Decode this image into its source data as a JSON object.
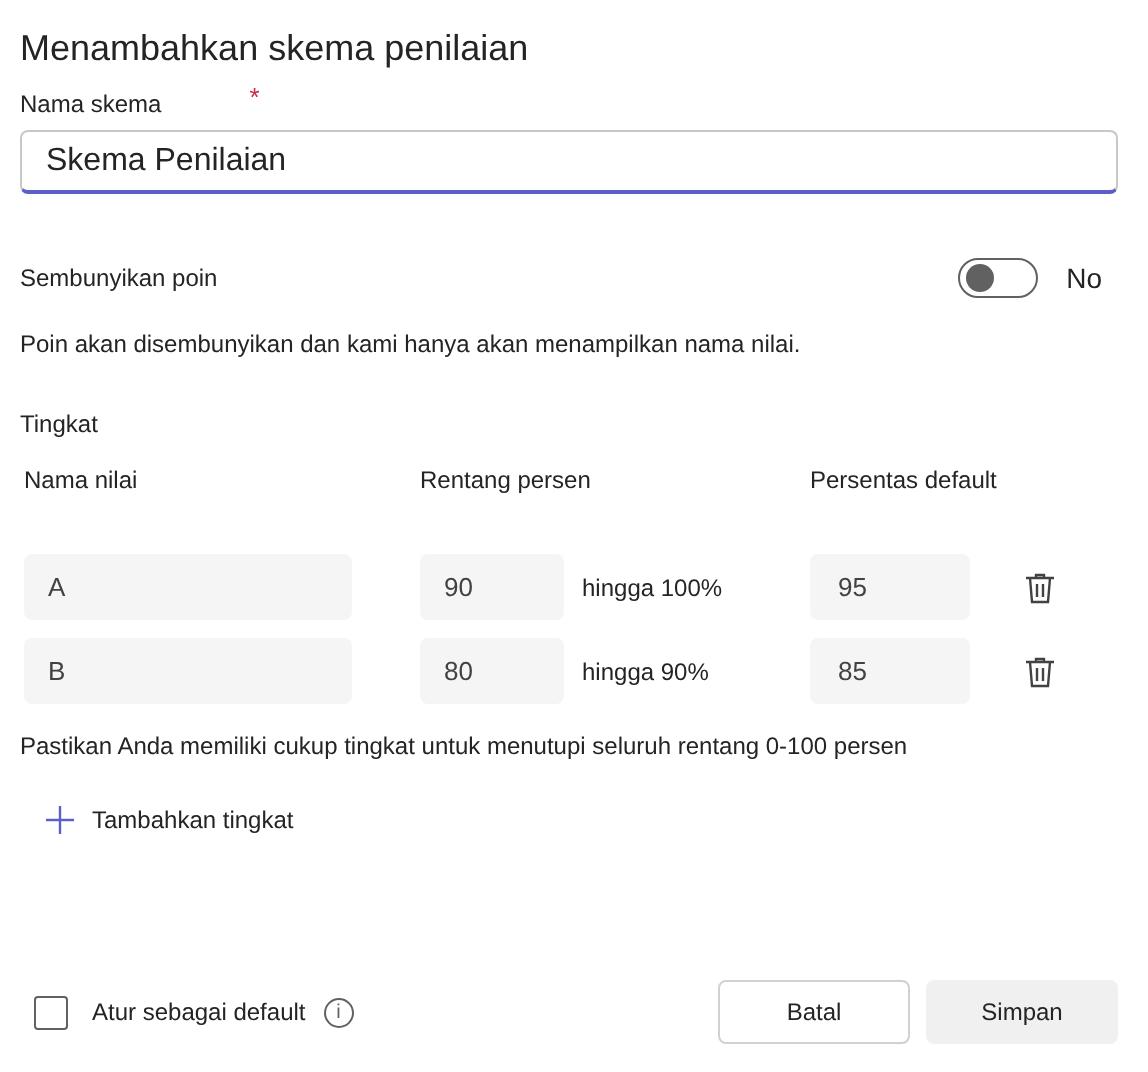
{
  "title": "Menambahkan skema penilaian",
  "scheme_name": {
    "label": "Nama skema",
    "required_mark": "*",
    "value": "Skema Penilaian"
  },
  "hide_points": {
    "label": "Sembunyikan poin",
    "on": false,
    "state_text": "No",
    "description": "Poin akan disembunyikan dan kami hanya akan menampilkan nama nilai."
  },
  "levels": {
    "title": "Tingkat",
    "columns": [
      "Nama nilai",
      "Rentang persen",
      "Persentas default"
    ],
    "rows": [
      {
        "name": "A",
        "from": "90",
        "to_text": "hingga 100%",
        "default": "95"
      },
      {
        "name": "B",
        "from": "80",
        "to_text": "hingga 90%",
        "default": "85"
      }
    ],
    "note": "Pastikan Anda memiliki cukup tingkat untuk menutupi seluruh rentang 0-100 persen",
    "add_label": "Tambahkan tingkat"
  },
  "footer": {
    "default_checkbox": {
      "label": "Atur sebagai default",
      "checked": false
    },
    "info_icon": "i",
    "buttons": [
      {
        "label": "Batal",
        "kind": "secondary",
        "disabled": false
      },
      {
        "label": "Simpan",
        "kind": "primary",
        "disabled": true
      }
    ]
  }
}
